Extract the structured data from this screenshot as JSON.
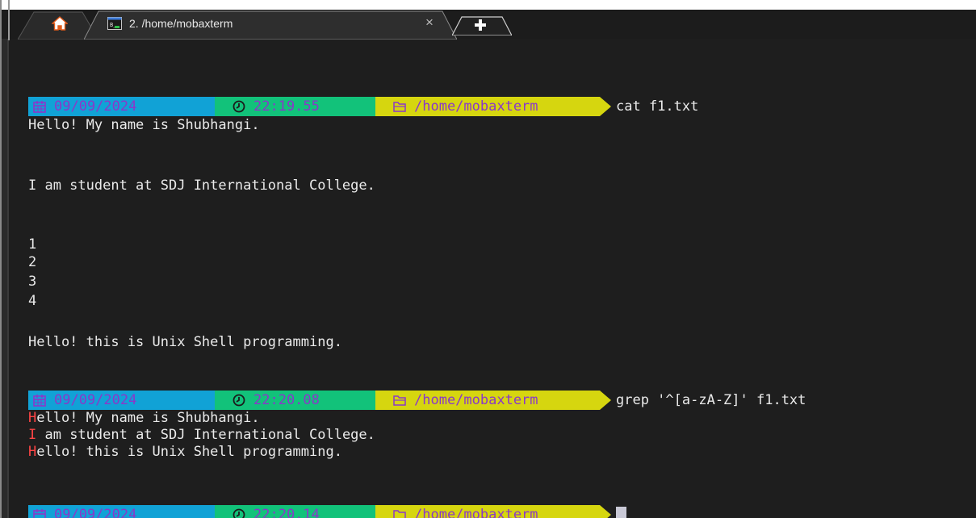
{
  "tabs": {
    "home_icon": "home-icon",
    "session": {
      "icon": "terminal-icon",
      "title": "2. /home/mobaxterm",
      "close": "×"
    },
    "new_tab_icon": "plus-icon"
  },
  "terminal": {
    "blocks": [
      {
        "date": "09/09/2024",
        "time": "22:19.55",
        "dir": "/home/mobaxterm",
        "command": "cat f1.txt"
      },
      {
        "date": "09/09/2024",
        "time": "22:20.08",
        "dir": "/home/mobaxterm",
        "command": "grep '^[a-zA-Z]' f1.txt"
      },
      {
        "date": "09/09/2024",
        "time": "22:20.14",
        "dir": "/home/mobaxterm",
        "command": ""
      }
    ],
    "cat_output": [
      "Hello! My name is Shubhangi.",
      "",
      "",
      "I am student at SDJ International College.",
      "",
      "",
      "1",
      "2",
      "3",
      "4",
      "",
      "Hello! this is Unix Shell programming."
    ],
    "grep_output": [
      {
        "match": "H",
        "rest": "ello! My name is Shubhangi."
      },
      {
        "match": "I",
        "rest": " am student at SDJ International College."
      },
      {
        "match": "H",
        "rest": "ello! this is Unix Shell programming."
      }
    ]
  },
  "colors": {
    "background": "#1e1e1e",
    "date_segment": "#11a2d6",
    "time_segment": "#12c27a",
    "dir_segment": "#d6d60f",
    "prompt_text": "#8a38c9",
    "grep_match": "#ff4545"
  }
}
